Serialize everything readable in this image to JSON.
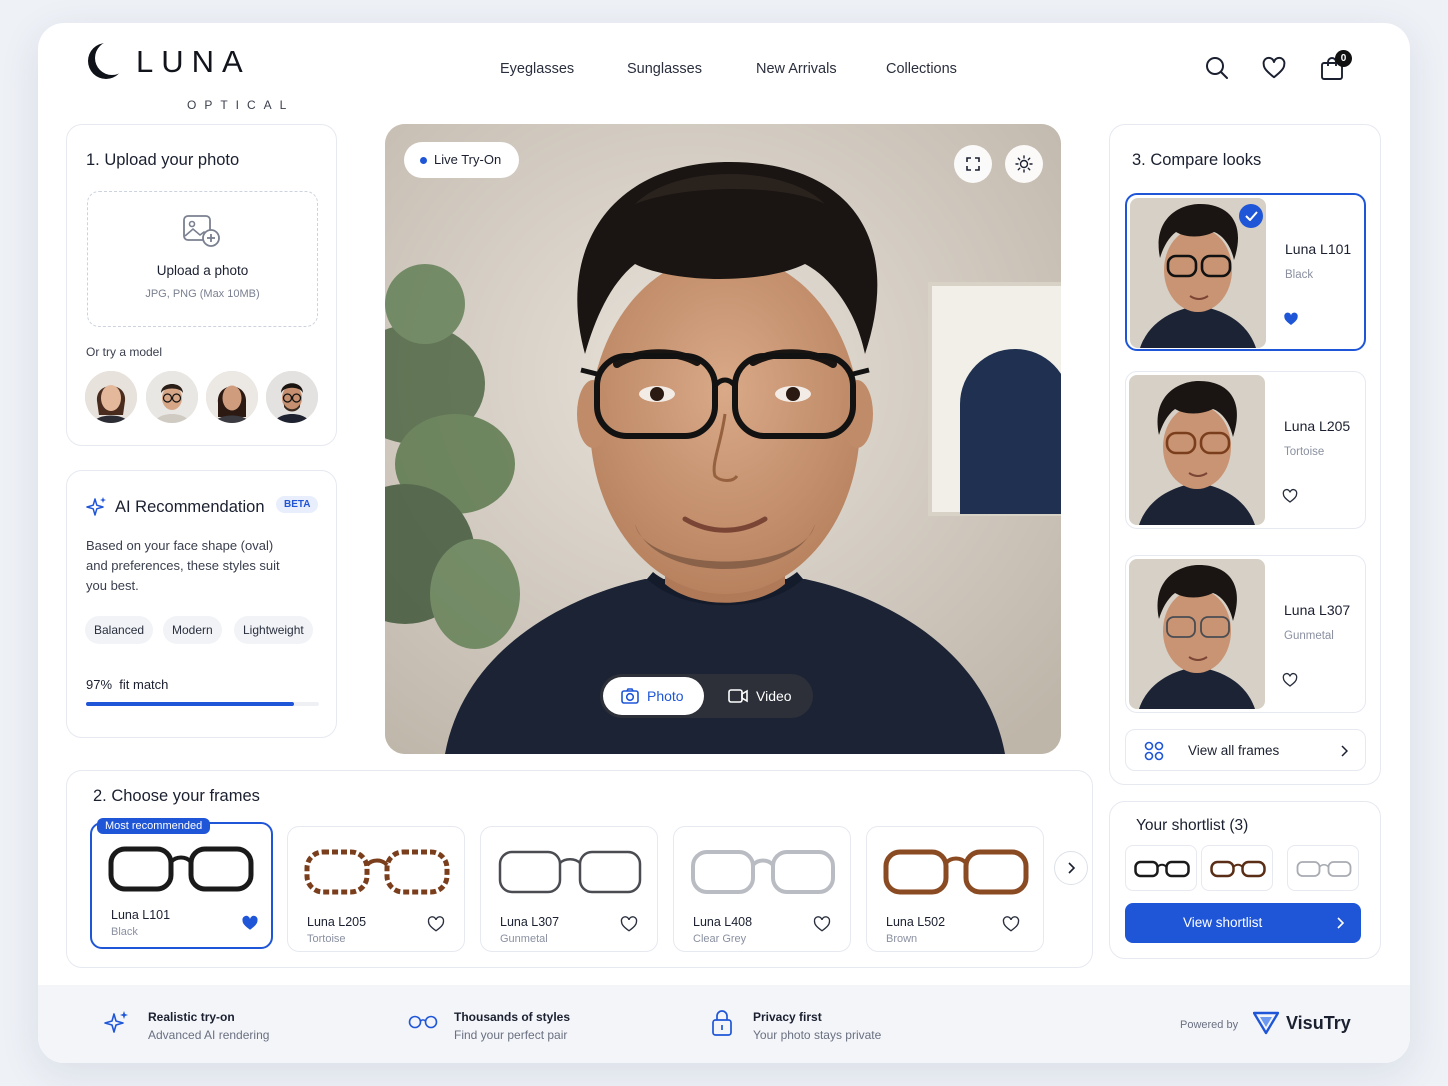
{
  "brand": {
    "name": "LUNA",
    "sub": "OPTICAL"
  },
  "nav": [
    {
      "label": "Eyeglasses"
    },
    {
      "label": "Sunglasses"
    },
    {
      "label": "New Arrivals"
    },
    {
      "label": "Collections"
    }
  ],
  "header": {
    "cart_count": "0",
    "icons": [
      "search-icon",
      "heart-icon",
      "shopping-bag-icon"
    ]
  },
  "upload": {
    "title": "1. Upload your photo",
    "button": "Upload a photo",
    "hint": "JPG, PNG (Max 10MB)",
    "models_label": "Or try a model"
  },
  "ai": {
    "title": "AI Recommendation",
    "badge": "BETA",
    "text": "Based on your face shape (oval) and preferences, these styles suit you best.",
    "chips": [
      "Balanced",
      "Modern",
      "Lightweight"
    ],
    "fit_value": "97%",
    "fit_label": "fit match",
    "fit_fraction": 0.97
  },
  "tryon": {
    "live_label": "Live Try-On",
    "photo_label": "Photo",
    "video_label": "Video"
  },
  "frames": {
    "title": "2. Choose your frames",
    "recommended_tag": "Most recommended",
    "items": [
      {
        "name": "Luna L101",
        "color": "Black",
        "favorited": true,
        "frame_color": "#1a1a1a"
      },
      {
        "name": "Luna L205",
        "color": "Tortoise",
        "favorited": false,
        "frame_color": "#7a3e1c"
      },
      {
        "name": "Luna L307",
        "color": "Gunmetal",
        "favorited": false,
        "frame_color": "#4a4c52"
      },
      {
        "name": "Luna L408",
        "color": "Clear Grey",
        "favorited": false,
        "frame_color": "#b9bcc2"
      },
      {
        "name": "Luna L502",
        "color": "Brown",
        "favorited": false,
        "frame_color": "#8a4a22"
      }
    ]
  },
  "compare": {
    "title": "3. Compare looks",
    "items": [
      {
        "name": "Luna L101",
        "color": "Black",
        "favorited": true
      },
      {
        "name": "Luna L205",
        "color": "Tortoise",
        "favorited": false
      },
      {
        "name": "Luna L307",
        "color": "Gunmetal",
        "favorited": false
      }
    ],
    "view_all": "View all frames"
  },
  "shortlist": {
    "title": "Your shortlist (3)",
    "button": "View shortlist"
  },
  "footer": {
    "features": [
      {
        "title": "Realistic try-on",
        "sub": "Advanced AI rendering",
        "icon": "sparkle-icon"
      },
      {
        "title": "Thousands of styles",
        "sub": "Find your perfect pair",
        "icon": "glasses-icon"
      },
      {
        "title": "Privacy first",
        "sub": "Your photo stays private",
        "icon": "lock-icon"
      }
    ],
    "powered_by": "Powered by",
    "partner": "VisuTry"
  },
  "colors": {
    "accent": "#1f56d8",
    "text": "#1b2030",
    "muted": "#8a90a0"
  }
}
